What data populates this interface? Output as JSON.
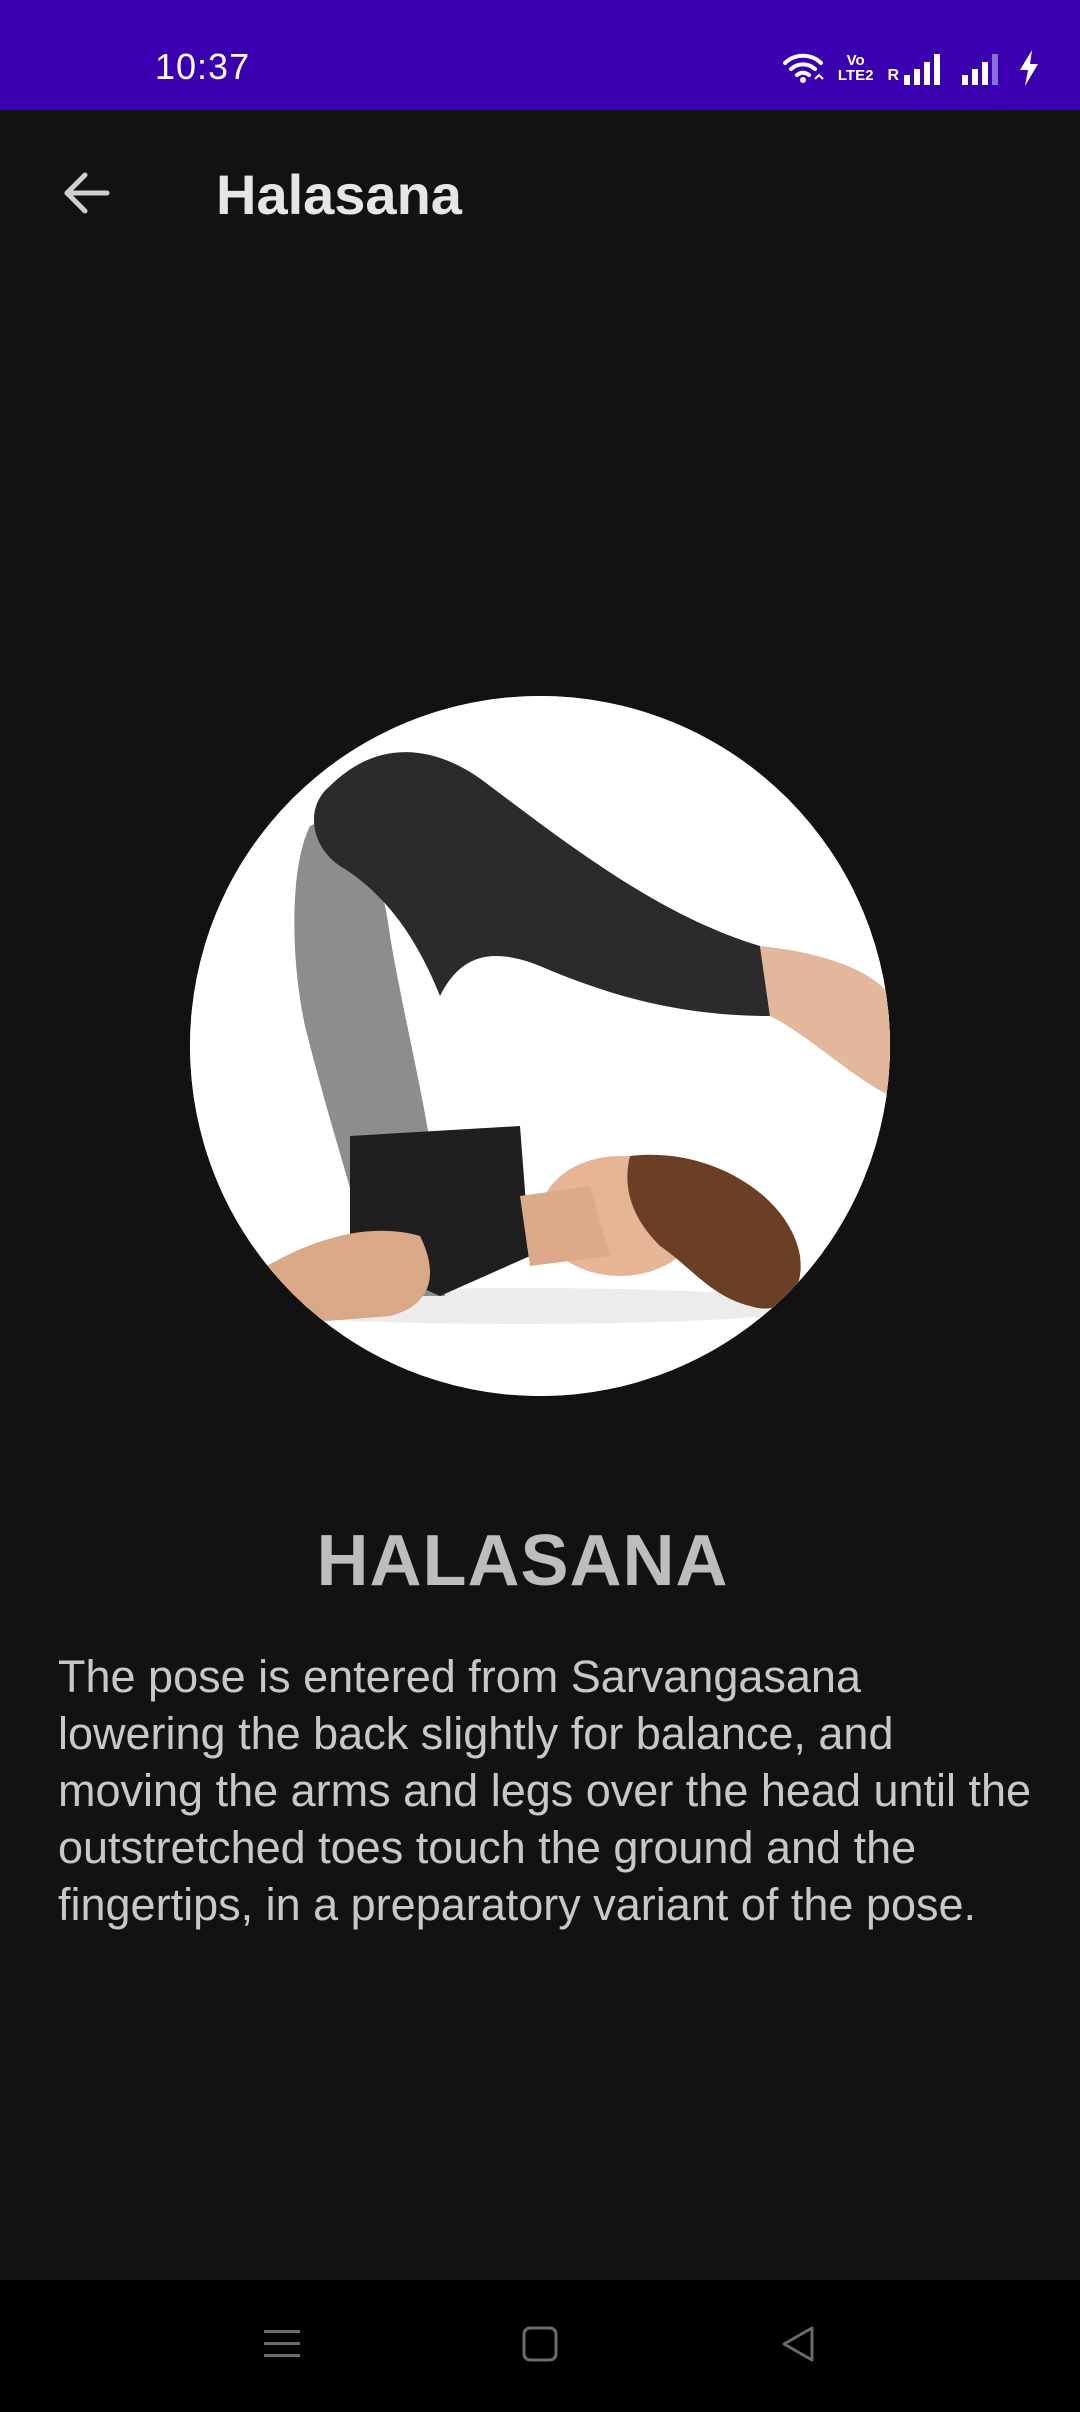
{
  "status_bar": {
    "time": "10:37",
    "volte_top": "Vo",
    "volte_bottom": "LTE2",
    "roaming_label": "R",
    "icons": [
      "wifi-icon",
      "volte-icon",
      "signal-roaming-icon",
      "signal-icon",
      "charging-icon"
    ],
    "background": "#3a00b0"
  },
  "app_bar": {
    "title": "Halasana",
    "back_icon": "arrow-left-icon"
  },
  "pose": {
    "name": "HALASANA",
    "description": "The pose is entered from Sarvangasana lowering the back slightly for balance, and moving the arms and legs over the head until the outstretched toes touch the ground and the fingertips, in a preparatory variant of the pose."
  },
  "nav_bar": {
    "icons": [
      "menu-icon",
      "home-square-icon",
      "back-triangle-icon"
    ]
  },
  "colors": {
    "background": "#121212",
    "title_text": "#e6e6e6",
    "pose_name_text": "#bdbdbd",
    "body_text": "#c8c8c8"
  }
}
